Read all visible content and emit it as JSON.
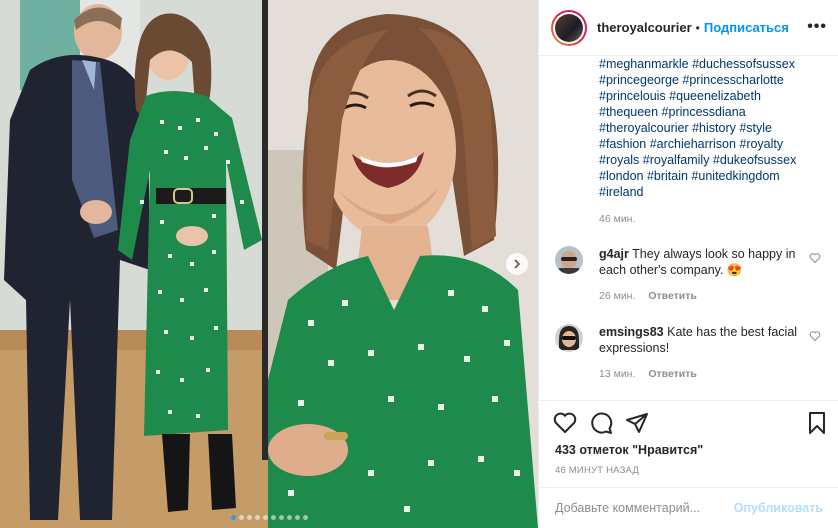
{
  "post": {
    "image_count": 10,
    "active_index": 0
  },
  "header": {
    "username": "theroyalcourier",
    "separator": "•",
    "follow_label": "Подписаться",
    "more_label": "•••"
  },
  "caption": {
    "hashtags": [
      "#meghanmarkle #duchessofsussex",
      "#princegeorge #princesscharlotte",
      "#princelouis #queenelizabeth",
      "#thequeen #princessdiana",
      "#theroyalcourier #history #style",
      "#fashion #archieharrison #royalty",
      "#royals #royalfamily #dukeofsussex",
      "#london #britain #unitedkingdom",
      "#ireland"
    ],
    "time": "46 мин."
  },
  "comments": [
    {
      "username": "g4ajr",
      "text": "They always look so happy in each other's company. 😍",
      "time": "26 мин.",
      "reply_label": "Ответить"
    },
    {
      "username": "emsings83",
      "text": "Kate has the best facial expressions!",
      "time": "13 мин.",
      "reply_label": "Ответить"
    }
  ],
  "likes": {
    "text": "433 отметок \"Нравится\""
  },
  "post_time": "46 МИНУТ НАЗАД",
  "add_comment": {
    "placeholder": "Добавьте комментарий...",
    "publish_label": "Опубликовать"
  },
  "colors": {
    "link": "#00376b",
    "follow": "#0095f6",
    "muted": "#8e8e8e",
    "dress_green": "#1e8a4c",
    "dot_active": "#3897f0"
  }
}
